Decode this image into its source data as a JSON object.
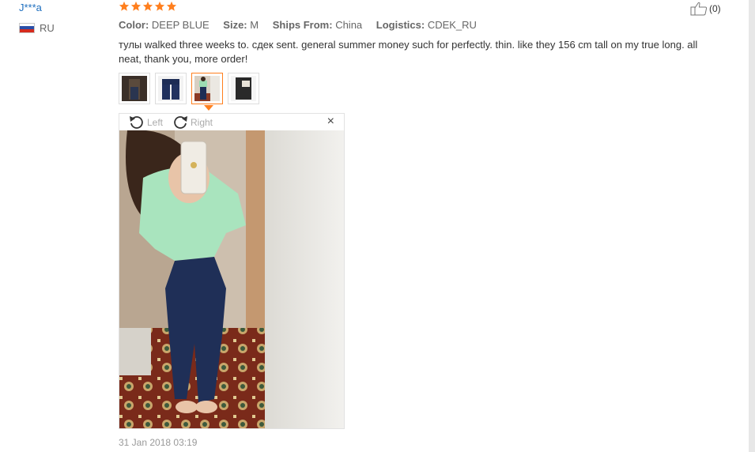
{
  "review": {
    "user_name": "J***a",
    "country": "RU",
    "rating": 5,
    "helpful_count": "(0)",
    "meta": {
      "color_label": "Color:",
      "color_value": "DEEP BLUE",
      "size_label": "Size:",
      "size_value": "M",
      "ships_label": "Ships From:",
      "ships_value": "China",
      "logistics_label": "Logistics:",
      "logistics_value": "CDEK_RU"
    },
    "text": "тулы walked three weeks to. сдек sent. general summer money such for perfectly. thin. like they 156 cm tall on my true long. all neat, thank you, more order!",
    "thumbnails": 4,
    "active_thumbnail": 3,
    "viewer": {
      "rotate_left_label": "Left",
      "rotate_right_label": "Right",
      "close_symbol": "×"
    },
    "date": "31 Jan 2018 03:19"
  },
  "colors": {
    "link_blue": "#1e6fbf",
    "star_orange": "#ff7f1e",
    "meta_gray": "#666666"
  },
  "icons": [
    "flag-ru-icon",
    "star-icon",
    "thumbs-up-icon",
    "rotate-left-icon",
    "rotate-right-icon",
    "close-icon"
  ]
}
